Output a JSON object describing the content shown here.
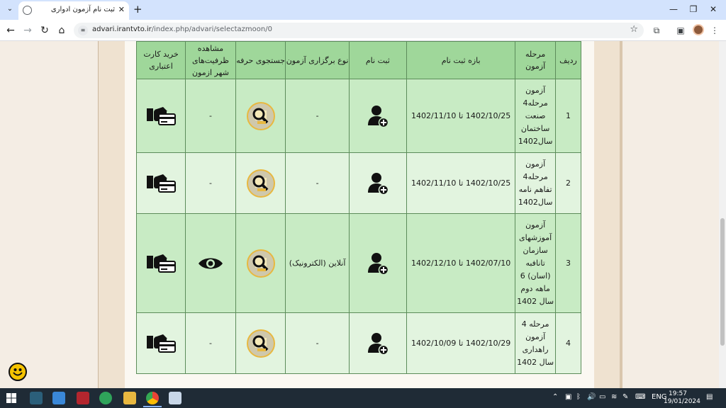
{
  "browser": {
    "tab_title": "ثبت نام آزمون ادواری",
    "url_host": "advari.irantvto.ir",
    "url_path": "/index.php/advari/selectazmoon/0"
  },
  "table": {
    "headers": {
      "index": "ردیف",
      "stage": "مرحله آزمون",
      "period": "بازه ثبت نام",
      "register": "ثبت نام",
      "type": "نوع برگزاری آزمون",
      "search": "جستجوی حرفه",
      "capacity": "مشاهده ظرفیت‌های شهر ازمون",
      "card": "خرید کارت اعتباری"
    },
    "rows": [
      {
        "index": "1",
        "stage": "آزمون مرحله4 صنعت ساختمان سال1402",
        "period": "1402/10/25 تا 1402/11/10",
        "type": "-",
        "capacity": "-"
      },
      {
        "index": "2",
        "stage": "آزمون مرحله4 تفاهم نامه سال1402",
        "period": "1402/10/25 تا 1402/11/10",
        "type": "-",
        "capacity": "-"
      },
      {
        "index": "3",
        "stage": "آزمون آموزشهای سازمان تانافبه (اسان) 6 ماهه دوم سال 1402",
        "period": "1402/07/10 تا 1402/12/10",
        "type": "آنلاین (الکترونیک)",
        "capacity": "eye-icon"
      },
      {
        "index": "4",
        "stage": "مرحله 4 آزمون راهداری سال 1402",
        "period": "1402/10/29 تا 1402/10/09",
        "type": "-",
        "capacity": "-"
      }
    ]
  },
  "taskbar": {
    "language": "ENG",
    "time": "19:57",
    "date": "19/01/2024"
  },
  "colors": {
    "header_bg": "#9fd79a",
    "row_odd": "#c8ebc4",
    "row_even": "#e2f4df",
    "panel_bg": "#efe2d0"
  }
}
